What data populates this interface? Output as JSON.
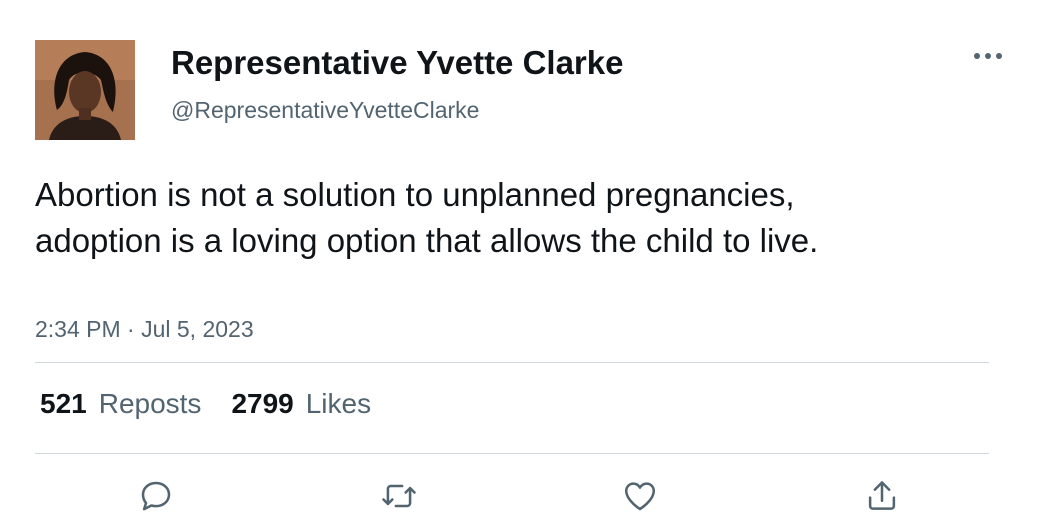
{
  "author": {
    "display_name": "Representative Yvette Clarke",
    "handle": "@RepresentativeYvetteClarke",
    "avatar_icon": "profile-photo"
  },
  "tweet": {
    "text": "Abortion is not a solution to unplanned pregnancies, adoption is a loving option that allows the child to live.",
    "timestamp": "2:34 PM · Jul 5, 2023"
  },
  "stats": {
    "reposts_count": "521",
    "reposts_label": "Reposts",
    "likes_count": "2799",
    "likes_label": "Likes"
  },
  "actions": [
    "reply-icon",
    "repost-icon",
    "like-icon",
    "share-icon"
  ],
  "colors": {
    "text_primary": "#0f1419",
    "text_secondary": "#536471",
    "divider": "#cfd9de"
  }
}
